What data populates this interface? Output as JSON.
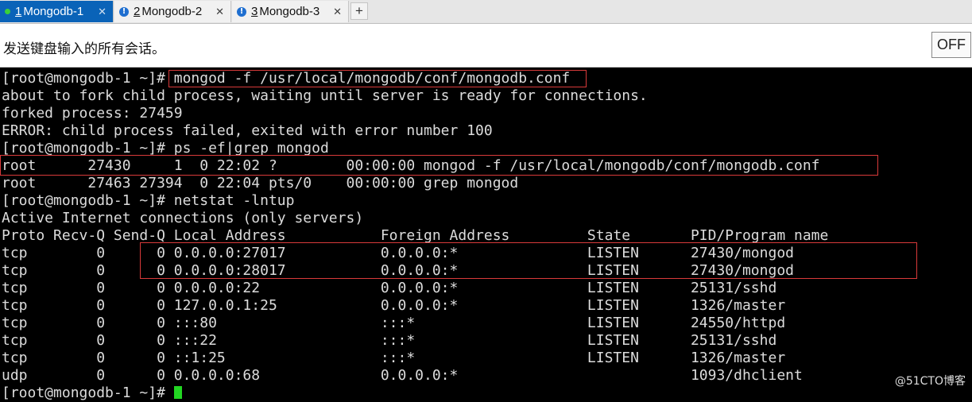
{
  "tabs": [
    {
      "number": "1",
      "title": "Mongodb-1",
      "active": true
    },
    {
      "number": "2",
      "title": "Mongodb-2",
      "active": false
    },
    {
      "number": "3",
      "title": "Mongodb-3",
      "active": false
    }
  ],
  "add_tab_label": "+",
  "close_glyph": "✕",
  "send_bar": {
    "label": "发送键盘输入的所有会话。",
    "toggle": "OFF"
  },
  "terminal": {
    "lines": [
      "[root@mongodb-1 ~]# mongod -f /usr/local/mongodb/conf/mongodb.conf",
      "about to fork child process, waiting until server is ready for connections.",
      "forked process: 27459",
      "ERROR: child process failed, exited with error number 100",
      "[root@mongodb-1 ~]# ps -ef|grep mongod",
      "root      27430     1  0 22:02 ?        00:00:00 mongod -f /usr/local/mongodb/conf/mongodb.conf",
      "root      27463 27394  0 22:04 pts/0    00:00:00 grep mongod",
      "[root@mongodb-1 ~]# netstat -lntup",
      "Active Internet connections (only servers)",
      "Proto Recv-Q Send-Q Local Address           Foreign Address         State       PID/Program name",
      "tcp        0      0 0.0.0.0:27017           0.0.0.0:*               LISTEN      27430/mongod",
      "tcp        0      0 0.0.0.0:28017           0.0.0.0:*               LISTEN      27430/mongod",
      "tcp        0      0 0.0.0.0:22              0.0.0.0:*               LISTEN      25131/sshd",
      "tcp        0      0 127.0.0.1:25            0.0.0.0:*               LISTEN      1326/master",
      "tcp        0      0 :::80                   :::*                    LISTEN      24550/httpd",
      "tcp        0      0 :::22                   :::*                    LISTEN      25131/sshd",
      "tcp        0      0 ::1:25                  :::*                    LISTEN      1326/master",
      "udp        0      0 0.0.0.0:68              0.0.0.0:*                           1093/dhclient"
    ],
    "prompt": "[root@mongodb-1 ~]# "
  },
  "colors": {
    "highlight": "#d93a3a",
    "cursor": "#22d622",
    "tab_active": "#0a63b8"
  },
  "watermark": "@51CTO博客"
}
